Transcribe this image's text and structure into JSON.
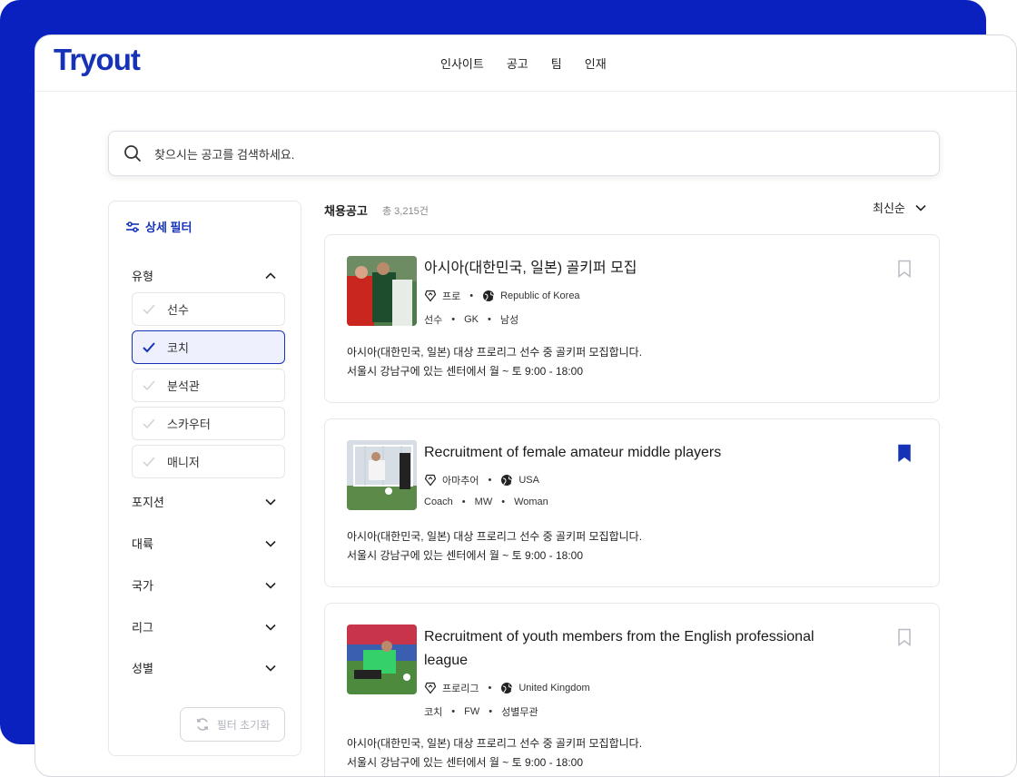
{
  "logo": "Tryout",
  "nav": [
    "인사이트",
    "공고",
    "팀",
    "인재"
  ],
  "search": {
    "placeholder": "찾으시는 공고를 검색하세요."
  },
  "filters": {
    "title": "상세 필터",
    "type_label": "유형",
    "type_options": [
      {
        "label": "선수",
        "selected": false
      },
      {
        "label": "코치",
        "selected": true
      },
      {
        "label": "분석관",
        "selected": false
      },
      {
        "label": "스카우터",
        "selected": false
      },
      {
        "label": "매니저",
        "selected": false
      }
    ],
    "sections": [
      "포지션",
      "대륙",
      "국가",
      "리그",
      "성별"
    ],
    "reset_label": "필터 초기화"
  },
  "list": {
    "title": "채용공고",
    "count": "총 3,215건",
    "sort_label": "최신순"
  },
  "jobs": [
    {
      "title": "아시아(대한민국, 일본) 골키퍼 모집",
      "level": "프로",
      "country": "Republic of Korea",
      "tags": [
        "선수",
        "GK",
        "남성"
      ],
      "desc1": "아시아(대한민국, 일본) 대상 프로리그 선수 중 골키퍼 모집합니다.",
      "desc2": "서울시 강남구에 있는 센터에서 월 ~ 토 9:00 - 18:00",
      "bookmarked": false
    },
    {
      "title": "Recruitment of female amateur middle players",
      "level": "아마추어",
      "country": "USA",
      "tags": [
        "Coach",
        "MW",
        "Woman"
      ],
      "desc1": "아시아(대한민국, 일본) 대상 프로리그 선수 중 골키퍼 모집합니다.",
      "desc2": "서울시 강남구에 있는 센터에서 월 ~ 토 9:00 - 18:00",
      "bookmarked": true
    },
    {
      "title": "Recruitment of youth members from the English professional league",
      "level": "프로리그",
      "country": "United Kingdom",
      "tags": [
        "코치",
        "FW",
        "성별무관"
      ],
      "desc1": "아시아(대한민국, 일본) 대상 프로리그 선수 중 골키퍼 모집합니다.",
      "desc2": "서울시 강남구에 있는 센터에서 월 ~ 토 9:00 - 18:00",
      "bookmarked": false
    }
  ],
  "colors": {
    "brand": "#1633b8",
    "backdrop": "#0a21c0"
  }
}
